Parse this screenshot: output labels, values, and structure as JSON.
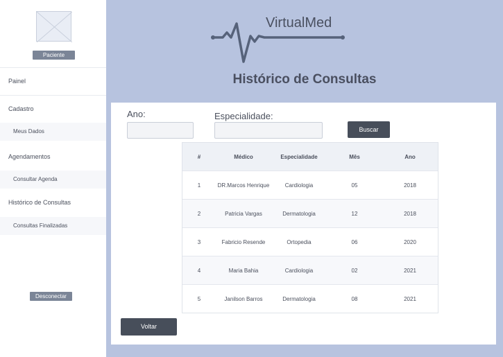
{
  "sidebar": {
    "profile_button": "Paciente",
    "items": {
      "painel": "Painel",
      "cadastro": "Cadastro",
      "meus_dados": "Meus Dados",
      "agendamentos": "Agendamentos",
      "consultar_agenda": "Consultar Agenda",
      "historico": "Histórico de Consultas",
      "consultas_finalizadas": "Consultas Finalizadas"
    },
    "disconnect_button": "Desconectar"
  },
  "header": {
    "brand": "VirtualMed",
    "title": "Histórico de Consultas"
  },
  "filters": {
    "year_label": "Ano:",
    "year_value": "",
    "specialty_label": "Especialidade:",
    "specialty_value": "",
    "search_button": "Buscar"
  },
  "table": {
    "columns": [
      "#",
      "Médico",
      "Especialidade",
      "Mês",
      "Ano"
    ],
    "rows": [
      [
        "1",
        "DR.Marcos Henrique",
        "Cardiologia",
        "05",
        "2018"
      ],
      [
        "2",
        "Patricia Vargas",
        "Dermatologia",
        "12",
        "2018"
      ],
      [
        "3",
        "Fabricio Resende",
        "Ortopedia",
        "06",
        "2020"
      ],
      [
        "4",
        "Maria Bahia",
        "Cardiologia",
        "02",
        "2021"
      ],
      [
        "5",
        "Janilson Barros",
        "Dermatologia",
        "08",
        "2021"
      ]
    ]
  },
  "footer": {
    "back_button": "Voltar"
  }
}
